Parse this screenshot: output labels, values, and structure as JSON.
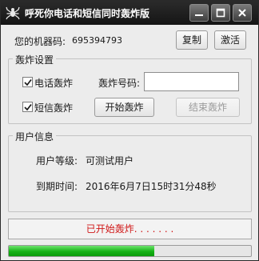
{
  "window": {
    "title": "呼死你电话和短信同时轰炸版"
  },
  "machine": {
    "label": "您的机器码:",
    "code": "695394793",
    "copy_label": "复制",
    "activate_label": "激活"
  },
  "bomb_settings": {
    "group_title": "轰炸设置",
    "phone_checkbox": {
      "label": "电话轰炸",
      "checked": true
    },
    "sms_checkbox": {
      "label": "短信轰炸",
      "checked": true
    },
    "number_label": "轰炸号码:",
    "number_value": "",
    "start_label": "开始轰炸",
    "stop_label": "结束轰炸"
  },
  "user_info": {
    "group_title": "用户信息",
    "level_label": "用户等级:",
    "level_value": "可测试用户",
    "expiry_label": "到期时间:",
    "expiry_value": "2016年6月7日15时31分48秒"
  },
  "status": {
    "text": "已开始轰炸. . . . . . ."
  },
  "progress": {
    "fraction": 0.6
  },
  "colors": {
    "status_text": "#d01818",
    "progress_fill": "#14b114",
    "titlebar": "#1e1e1e"
  },
  "icons": {
    "app": "spider-icon",
    "minimize": "minimize-icon",
    "maximize": "maximize-icon",
    "close": "close-icon"
  }
}
